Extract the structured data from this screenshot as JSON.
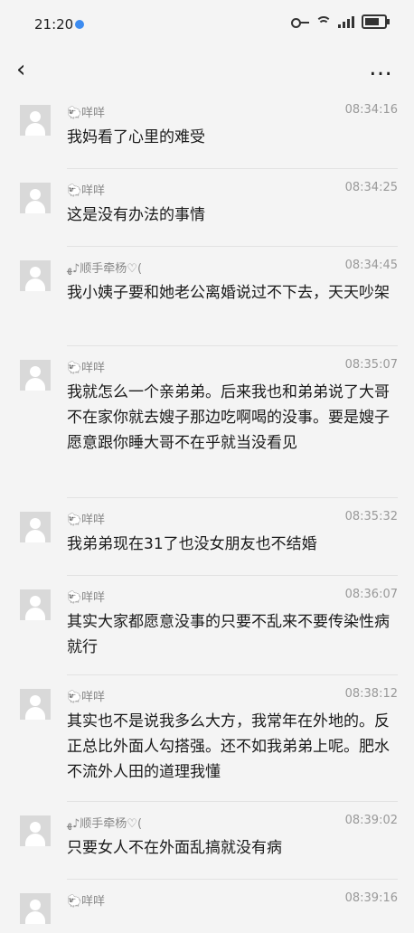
{
  "status": {
    "time": "21:20"
  },
  "nav": {
    "back_icon": "chevron-left",
    "more_icon": "more-horizontal"
  },
  "messages": [
    {
      "sender": "🐑咩咩",
      "time": "08:34:16",
      "text": "我妈看了心里的难受"
    },
    {
      "sender": "🐑咩咩",
      "time": "08:34:25",
      "text": "这是没有办法的事情"
    },
    {
      "sender": "ﻬ♪顺手牵杨♡(",
      "time": "08:34:45",
      "text": "我小姨子要和她老公离婚说过不下去，天天吵架"
    },
    {
      "sender": "🐑咩咩",
      "time": "08:35:07",
      "text": "我就怎么一个亲弟弟。后来我也和弟弟说了大哥不在家你就去嫂子那边吃啊喝的没事。要是嫂子愿意跟你睡大哥不在乎就当没看见"
    },
    {
      "sender": "🐑咩咩",
      "time": "08:35:32",
      "text": "我弟弟现在31了也没女朋友也不结婚"
    },
    {
      "sender": "🐑咩咩",
      "time": "08:36:07",
      "text": "其实大家都愿意没事的只要不乱来不要传染性病就行"
    },
    {
      "sender": "🐑咩咩",
      "time": "08:38:12",
      "text": "其实也不是说我多么大方，我常年在外地的。反正总比外面人勾搭强。还不如我弟弟上呢。肥水不流外人田的道理我懂"
    },
    {
      "sender": "ﻬ♪顺手牵杨♡(",
      "time": "08:39:02",
      "text": "只要女人不在外面乱搞就没有病"
    },
    {
      "sender": "🐑咩咩",
      "time": "08:39:16",
      "text": ""
    }
  ]
}
